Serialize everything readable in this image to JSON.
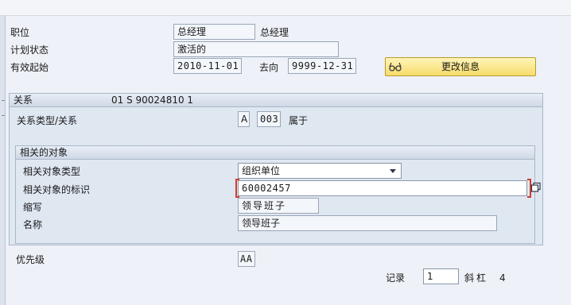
{
  "header": {
    "position_label": "职位",
    "position_value": "总经理",
    "position_text": "总经理",
    "planning_status_label": "计划状态",
    "planning_status_value": "激活的",
    "valid_from_label": "有效起始",
    "valid_from_value": "2010-11-01",
    "to_label": "去向",
    "valid_to_value": "9999-12-31",
    "change_info_label": "更改信息"
  },
  "relationship": {
    "title": "关系",
    "summary": "01 S  90024810 1",
    "type_label": "关系类型/关系",
    "type_code": "A",
    "rel_code": "003",
    "rel_text": "属于"
  },
  "related_object": {
    "title": "相关的对象",
    "type_label": "相关对象类型",
    "type_value": "组织单位",
    "id_label": "相关对象的标识",
    "id_value": "60002457",
    "abbr_label": "缩写",
    "abbr_value": "领导班子",
    "name_label": "名称",
    "name_value": "领导班子"
  },
  "priority": {
    "label": "优先级",
    "value": "AA"
  },
  "records": {
    "label": "记录",
    "value": "1",
    "separator": "斜杠",
    "total": "4"
  },
  "icons": {
    "change_info_icon": "glasses-icon",
    "copy_icon": "copy-icon"
  },
  "colors": {
    "background": "#eef1f7",
    "button_yellow": "#f6dc6a",
    "required_marker": "#d23b2b"
  }
}
